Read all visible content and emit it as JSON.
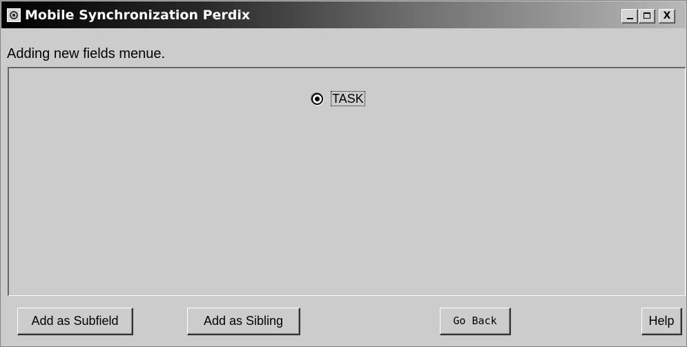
{
  "window": {
    "title": "Mobile Synchronization Perdix",
    "controls": {
      "minimize": "_",
      "maximize": "□",
      "close": "X"
    }
  },
  "main": {
    "heading": "Adding new fields menue.",
    "options": [
      {
        "label": "TASK",
        "selected": true
      }
    ]
  },
  "buttons": {
    "add_subfield": "Add as Subfield",
    "add_sibling": "Add as Sibling",
    "go_back": "Go Back",
    "help": "Help"
  },
  "colors": {
    "background": "#cccccc",
    "title_start": "#000000",
    "title_end": "#b8b8b8"
  }
}
